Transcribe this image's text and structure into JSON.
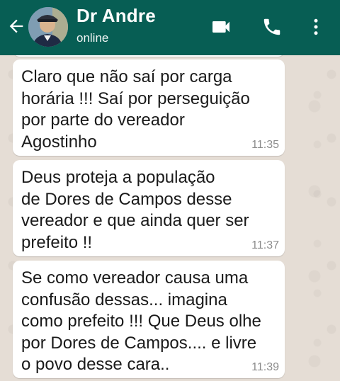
{
  "header": {
    "contact_name": "Dr Andre",
    "status": "online",
    "icons": {
      "back": "arrow-left-icon",
      "video": "video-camera-icon",
      "call": "phone-icon",
      "menu": "more-vertical-icon"
    },
    "colors": {
      "bar": "#075e54",
      "text": "#ffffff"
    }
  },
  "messages": [
    {
      "text": "Claro que não saí por carga\nhorária !!! Saí por perseguição\npor parte do vereador\nAgostinho",
      "time": "11:35"
    },
    {
      "text": "Deus proteja a população\nde Dores de Campos desse\nvereador e que ainda quer ser\nprefeito !!",
      "time": "11:37"
    },
    {
      "text": "Se como vereador causa uma\nconfusão dessas... imagina\ncomo prefeito !!! Que Deus olhe\npor Dores de Campos.... e livre\no povo desse cara..",
      "time": "11:39"
    }
  ],
  "colors": {
    "chat_background": "#e5ddd5",
    "bubble": "#ffffff",
    "timestamp": "#8c8c8c"
  }
}
